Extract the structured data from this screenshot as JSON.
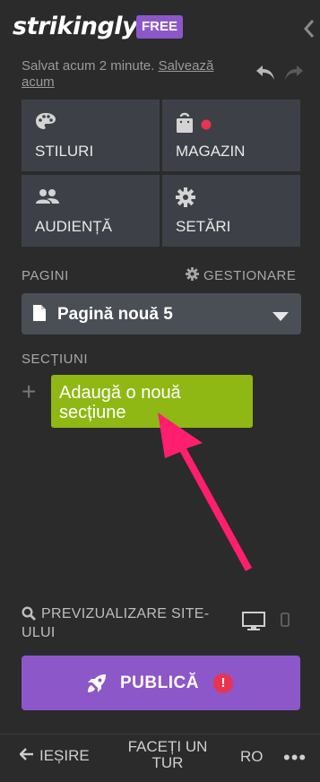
{
  "header": {
    "logo": "strikingly",
    "badge": "FREE"
  },
  "status": {
    "saved_text": "Salvat acum 2 minute.",
    "save_now": "Salvează acum"
  },
  "tiles": [
    {
      "label": "STILURI",
      "icon": "palette-icon"
    },
    {
      "label": "MAGAZIN",
      "icon": "shopping-bag-icon"
    },
    {
      "label": "AUDIENȚĂ",
      "icon": "people-icon"
    },
    {
      "label": "SETĂRI",
      "icon": "gear-icon"
    }
  ],
  "pages": {
    "heading": "PAGINI",
    "manage": "GESTIONARE",
    "current_page": "Pagină nouă 5"
  },
  "sections": {
    "heading": "SECȚIUNI",
    "add_label": "Adaugă o nouă secțiune"
  },
  "preview": {
    "label": "PREVIZUALIZARE SITE-ULUI"
  },
  "publish": {
    "label": "PUBLICĂ",
    "alert": "!"
  },
  "footer": {
    "exit": "IEȘIRE",
    "tour": "FACEȚI UN TUR",
    "language": "RO",
    "more": "•••"
  },
  "colors": {
    "background": "#2b2b2b",
    "tile": "#3d4147",
    "accent_purple": "#8c57c9",
    "add_section_green": "#8fb814",
    "arrow_pink": "#ff1f6e",
    "notification_red": "#e8344e"
  }
}
